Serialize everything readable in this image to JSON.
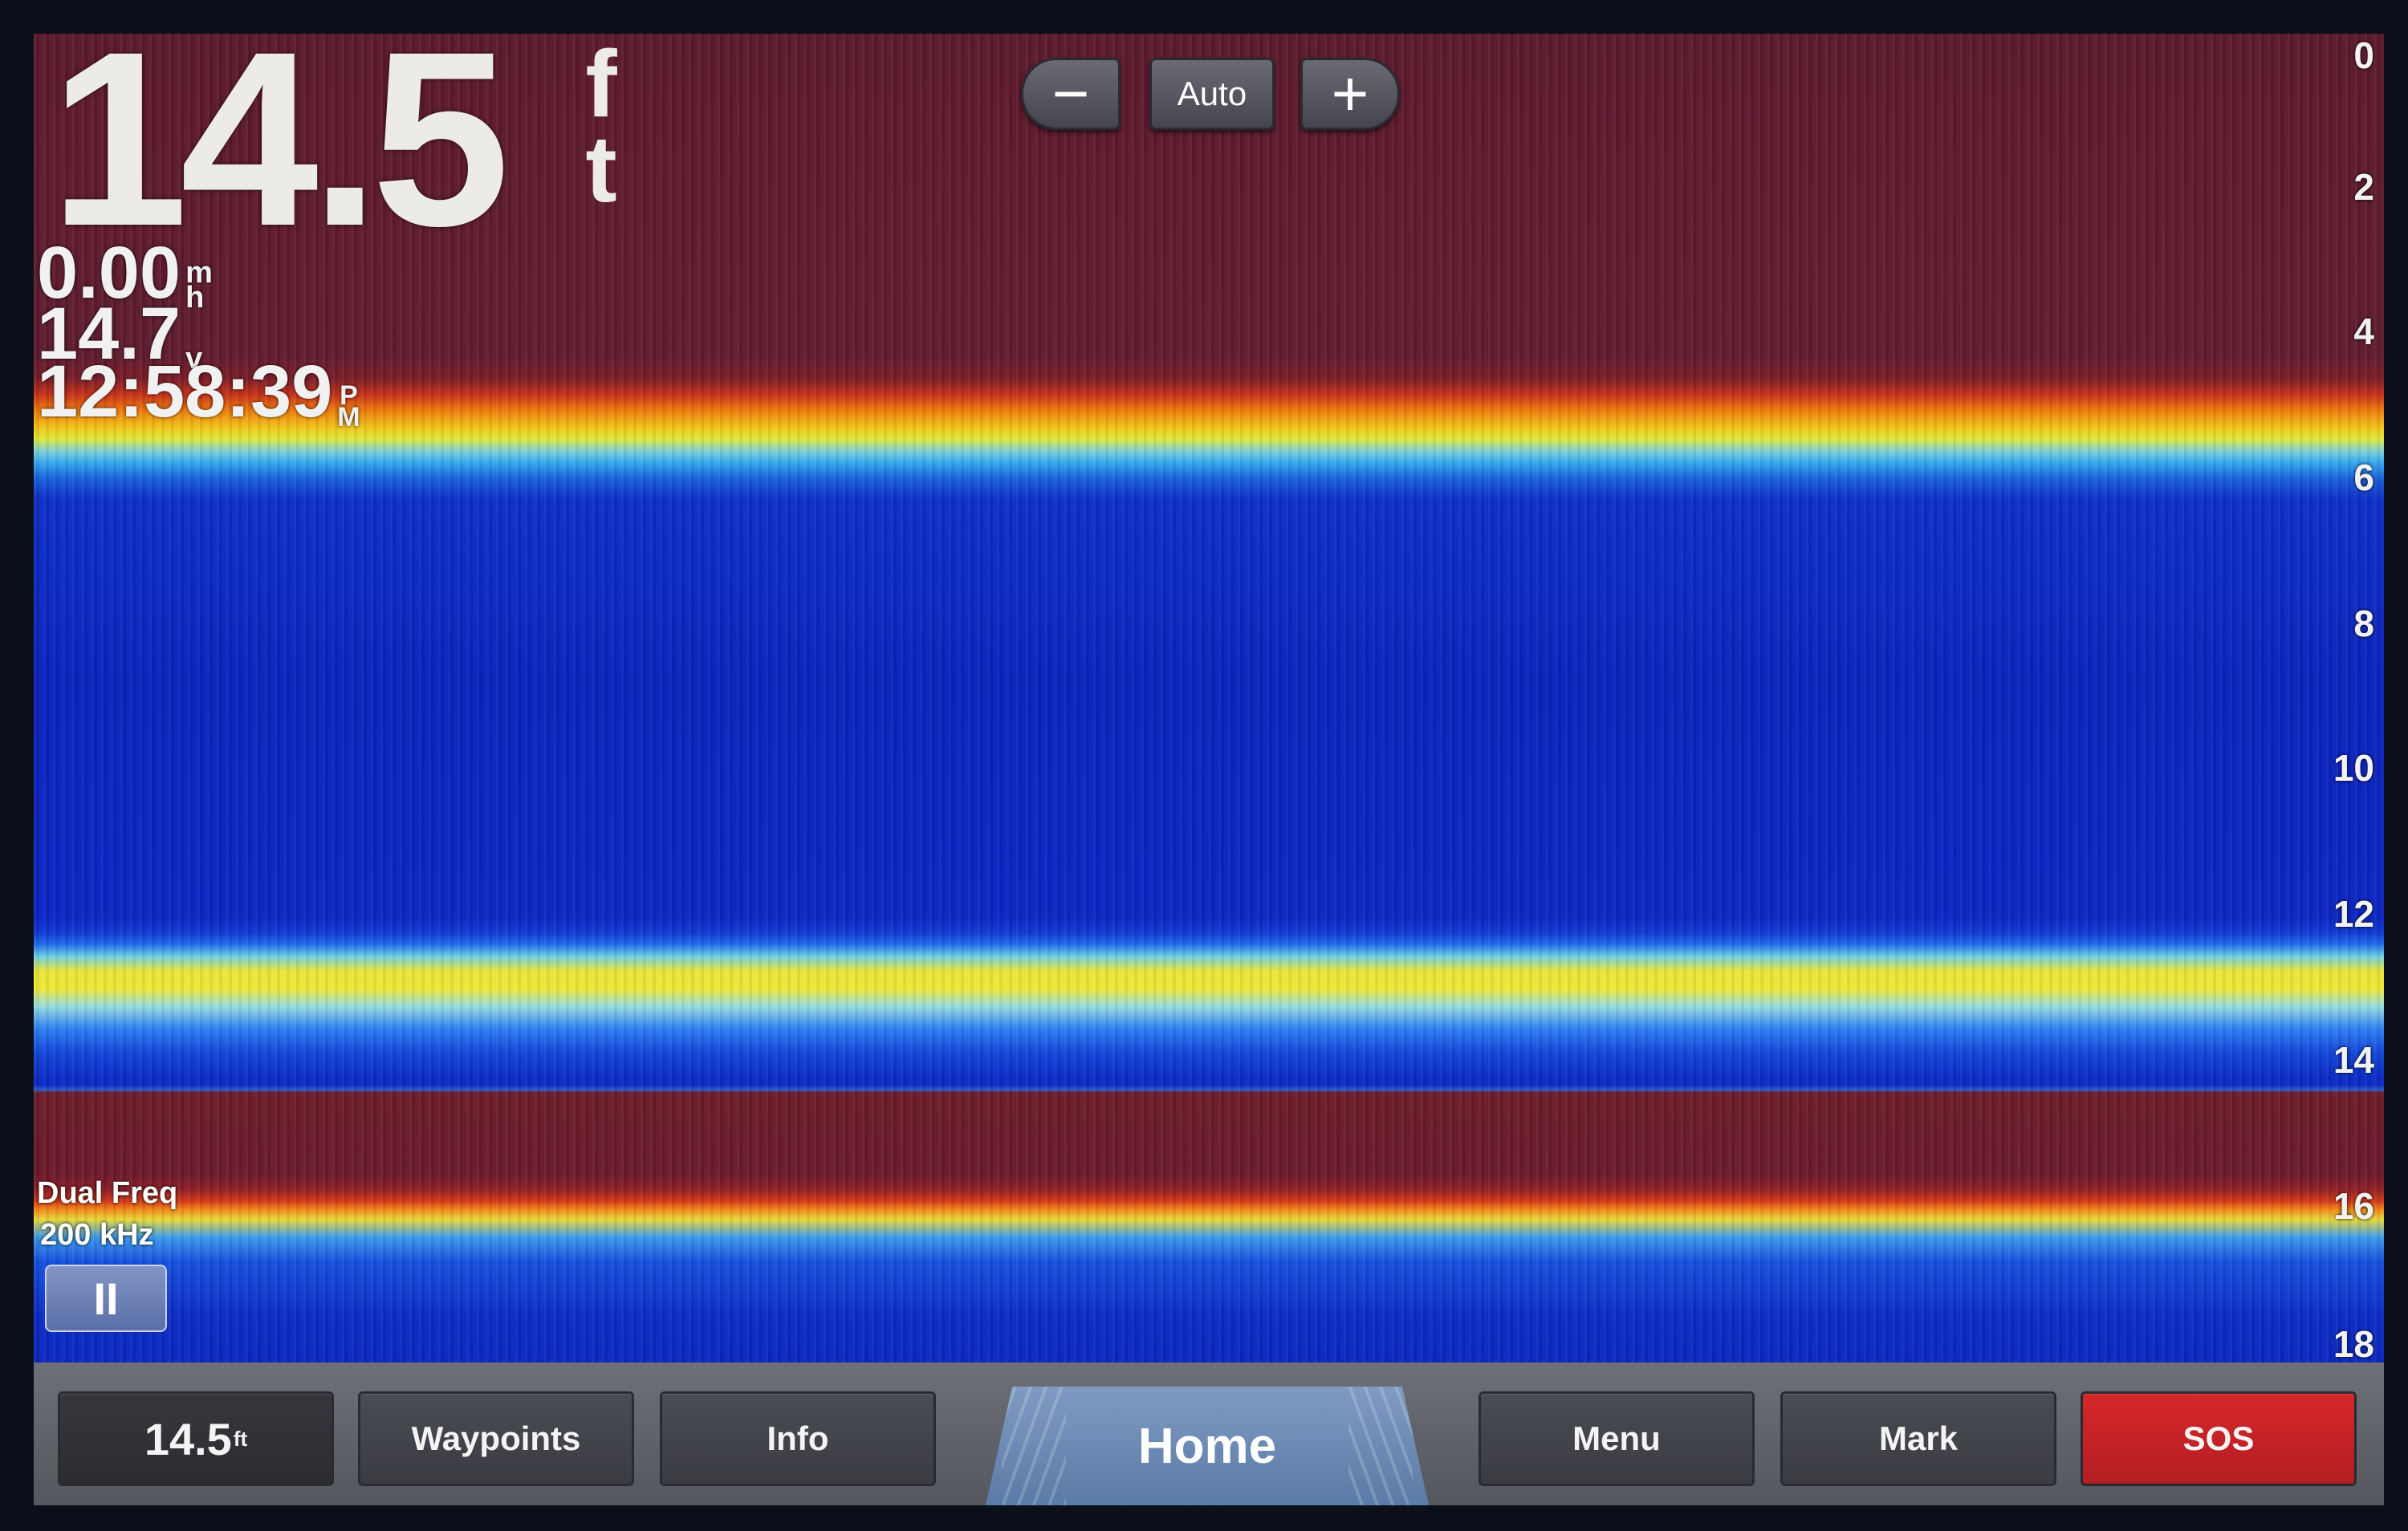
{
  "readouts": {
    "depth_value": "14.5",
    "depth_unit_top": "f",
    "depth_unit_bottom": "t",
    "speed_value": "0.00",
    "speed_unit_top": "m",
    "speed_unit_bottom": "h",
    "voltage_value": "14.7",
    "voltage_unit": "v",
    "time_value": "12:58:39",
    "time_unit_top": "P",
    "time_unit_bottom": "M"
  },
  "gain_controls": {
    "minus_label": "−",
    "auto_label": "Auto",
    "plus_label": "+"
  },
  "depth_scale": [
    "0",
    "2",
    "4",
    "6",
    "8",
    "10",
    "12",
    "14",
    "16",
    "18"
  ],
  "sonar_info": {
    "mode_label": "Dual Freq",
    "frequency": "200 kHz",
    "pause_label": "II"
  },
  "bottom_bar": {
    "depth_value": "14.5",
    "depth_unit": "ft",
    "waypoints_label": "Waypoints",
    "info_label": "Info",
    "home_label": "Home",
    "menu_label": "Menu",
    "mark_label": "Mark",
    "sos_label": "SOS"
  },
  "colors": {
    "sos": "#c82226",
    "home_tab": "#6f8db6",
    "water": "#0b25c0",
    "surface_band": "#5b1a2c"
  }
}
